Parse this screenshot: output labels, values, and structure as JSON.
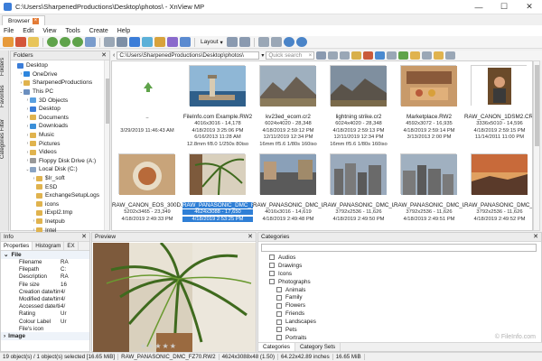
{
  "window": {
    "title": "C:\\Users\\SharpenedProductions\\Desktop\\photos\\ - XnView MP",
    "minimize": "—",
    "maximize": "☐",
    "close": "✕"
  },
  "tabs": [
    {
      "label": "Browser",
      "close": "×"
    }
  ],
  "menu": [
    "File",
    "Edit",
    "View",
    "Tools",
    "Create",
    "Help"
  ],
  "toolbar": {
    "layout_label": "Layout"
  },
  "sidetabs": [
    "Folders",
    "Favorites",
    "Categories Filter"
  ],
  "folders": {
    "title": "Folders",
    "items": [
      {
        "label": "Desktop",
        "indent": 0,
        "tw": "",
        "color": "#3b7dd8"
      },
      {
        "label": "OneDrive",
        "indent": 1,
        "tw": "›",
        "color": "#2e86de"
      },
      {
        "label": "SharpenedProductions",
        "indent": 1,
        "tw": "›",
        "color": "#e0b34e"
      },
      {
        "label": "This PC",
        "indent": 1,
        "tw": "⌄",
        "color": "#6b8fbf"
      },
      {
        "label": "3D Objects",
        "indent": 2,
        "tw": "›",
        "color": "#5aa0e0"
      },
      {
        "label": "Desktop",
        "indent": 2,
        "tw": "›",
        "color": "#3b7dd8"
      },
      {
        "label": "Documents",
        "indent": 2,
        "tw": "›",
        "color": "#e0b34e"
      },
      {
        "label": "Downloads",
        "indent": 2,
        "tw": "›",
        "color": "#3b8fd8"
      },
      {
        "label": "Music",
        "indent": 2,
        "tw": "›",
        "color": "#e0b34e"
      },
      {
        "label": "Pictures",
        "indent": 2,
        "tw": "›",
        "color": "#e0b34e"
      },
      {
        "label": "Videos",
        "indent": 2,
        "tw": "›",
        "color": "#e0b34e"
      },
      {
        "label": "Floppy Disk Drive (A:)",
        "indent": 2,
        "tw": "›",
        "color": "#999999"
      },
      {
        "label": "Local Disk (C:)",
        "indent": 2,
        "tw": "⌄",
        "color": "#8aa4c4"
      },
      {
        "label": "$Ir_soft",
        "indent": 3,
        "tw": "›",
        "color": "#e0b34e"
      },
      {
        "label": "ESD",
        "indent": 3,
        "tw": "",
        "color": "#e0b34e"
      },
      {
        "label": "ExchangeSetupLogs",
        "indent": 3,
        "tw": "",
        "color": "#e0b34e"
      },
      {
        "label": "icons",
        "indent": 3,
        "tw": "",
        "color": "#e0b34e"
      },
      {
        "label": "iExpl2.tmp",
        "indent": 3,
        "tw": "",
        "color": "#e0b34e"
      },
      {
        "label": "Inetpub",
        "indent": 3,
        "tw": "›",
        "color": "#e0b34e"
      },
      {
        "label": "Intel",
        "indent": 3,
        "tw": "›",
        "color": "#e0b34e"
      }
    ]
  },
  "address": {
    "path": "C:\\Users\\SharpenedProductions\\Desktop\\photos\\",
    "search_placeholder": "Quick search",
    "search_x": "×"
  },
  "thumbnails": [
    {
      "name": "..",
      "l1": "",
      "l2": "3/29/2019 11:46:43 AM",
      "l3": "",
      "sel": false,
      "art": "up"
    },
    {
      "name": "FileInfo.com Example.RW2",
      "l1": "4016x3016 - 14,178",
      "l2": "4/18/2019 3:25:06 PM",
      "l3": "6/16/2013 11:28 AM",
      "l4": "12.8mm f/8.0 1/250s 80iso",
      "sel": false,
      "art": "lighthouse"
    },
    {
      "name": "kv23ed_ecom.cr2",
      "l1": "6024x4020 - 28,348",
      "l2": "4/18/2019 2:59:12 PM",
      "l3": "12/11/2019 12:34 PM",
      "l4": "16mm f/5.6 1/80s 160iso",
      "sel": false,
      "art": "mountain"
    },
    {
      "name": "lightning strike.cr2",
      "l1": "6024x4020 - 28,348",
      "l2": "4/18/2019 2:59:13 PM",
      "l3": "12/11/2019 12:34 PM",
      "l4": "16mm f/5.6 1/80s 160iso",
      "sel": false,
      "art": "mountain2"
    },
    {
      "name": "Marketplace.RW2",
      "l1": "4592x3072 - 16,935",
      "l2": "4/18/2019 2:59:14 PM",
      "l3": "3/13/2013 2:00 PM",
      "l4": "",
      "sel": false,
      "art": "market"
    },
    {
      "name": "RAW_CANON_1DSM2.CR2",
      "l1": "3336x5010 - 14,596",
      "l2": "4/18/2019 2:59:15 PM",
      "l3": "11/14/2011 11:00 PM",
      "l4": "",
      "sel": false,
      "art": "portrait"
    },
    {
      "name": "RAW_CANON_EOS_300D.CR2",
      "l1": "5202x3465 - 23,349",
      "l2": "4/18/2019 2:49:33 PM",
      "sel": false,
      "art": "food"
    },
    {
      "name": "RAW_PANASONIC_DMC_FZ8...",
      "l1": "4624x3088 - 17,650",
      "l2": "4/18/2019 2:53:25 PM",
      "sel": true,
      "art": "palm"
    },
    {
      "name": "RAW_PANASONIC_DMC_LF1...",
      "l1": "4016x3016 - 14,619",
      "l2": "4/18/2019 2:49:48 PM",
      "sel": false,
      "art": "street"
    },
    {
      "name": "RAW_PANASONIC_DMC_LX7...",
      "l1": "3792x2536 - 11,626",
      "l2": "4/18/2019 2:49:50 PM",
      "sel": false,
      "art": "city"
    },
    {
      "name": "RAW_PANASONIC_DMC_LX7...",
      "l1": "3792x2536 - 11,626",
      "l2": "4/18/2019 2:49:51 PM",
      "sel": false,
      "art": "city2"
    },
    {
      "name": "RAW_PANASONIC_DMC_FZ8...",
      "l1": "3792x2536 - 11,626",
      "l2": "4/18/2019 2:49:52 PM",
      "sel": false,
      "art": "sunset"
    }
  ],
  "info": {
    "tabs": [
      "Properties",
      "Histogram",
      "EX"
    ],
    "group": "File",
    "rows": [
      {
        "k": "Filename",
        "v": "RA"
      },
      {
        "k": "Filepath",
        "v": "C:"
      },
      {
        "k": "Description",
        "v": "RA"
      },
      {
        "k": "File size",
        "v": "16"
      },
      {
        "k": "Creation date/time",
        "v": "4/"
      },
      {
        "k": "Modified date/time",
        "v": "4/"
      },
      {
        "k": "Accessed date/time",
        "v": "4/"
      },
      {
        "k": "Rating",
        "v": "Ur"
      },
      {
        "k": "Colour Label",
        "v": "Ur"
      },
      {
        "k": "File's icon",
        "v": ""
      }
    ],
    "group2": "Image"
  },
  "preview": {
    "title": "Preview",
    "stars": "★★★★★"
  },
  "categories": {
    "title": "Categories",
    "items": [
      {
        "label": "Audios",
        "indent": 1
      },
      {
        "label": "Drawings",
        "indent": 1
      },
      {
        "label": "Icons",
        "indent": 1
      },
      {
        "label": "Photographs",
        "indent": 1
      },
      {
        "label": "Animals",
        "indent": 2
      },
      {
        "label": "Family",
        "indent": 2
      },
      {
        "label": "Flowers",
        "indent": 2
      },
      {
        "label": "Friends",
        "indent": 2
      },
      {
        "label": "Landscapes",
        "indent": 2
      },
      {
        "label": "Pets",
        "indent": 2
      },
      {
        "label": "Portraits",
        "indent": 2
      },
      {
        "label": "Travel",
        "indent": 2
      }
    ],
    "bottom_tabs": [
      "Categories",
      "Category Sets"
    ],
    "watermark": "© FileInfo.com"
  },
  "status": [
    "19 object(s) / 1 object(s) selected [16.65 MiB]",
    "RAW_PANASONIC_DMC_FZ70.RW2",
    "4624x3088x48 (1.50)",
    "64.22x42.89 inches",
    "16.65 MiB"
  ]
}
